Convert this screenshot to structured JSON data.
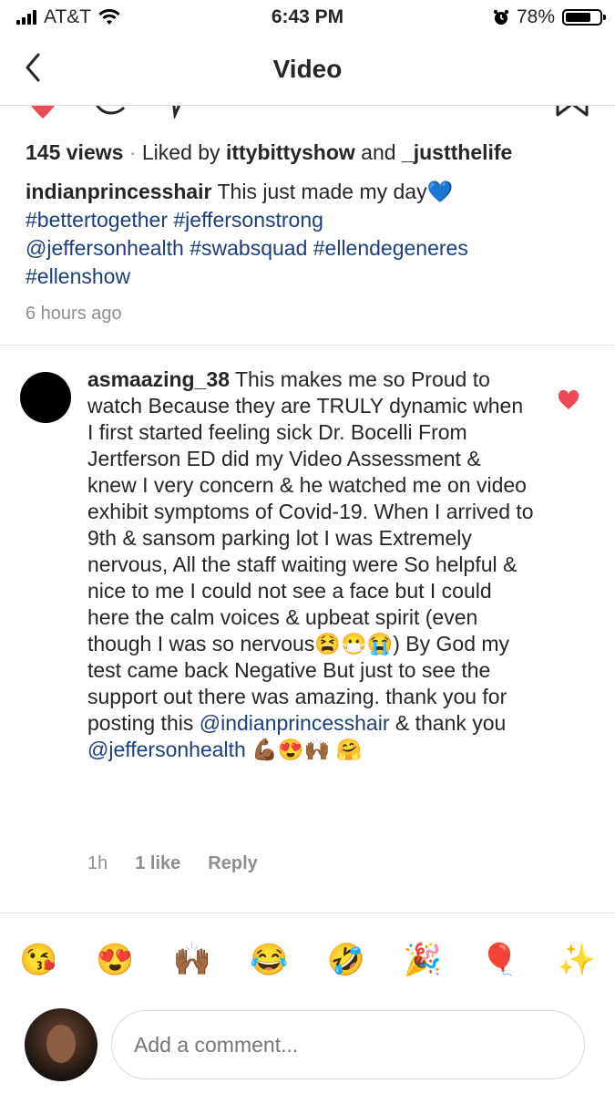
{
  "status_bar": {
    "carrier": "AT&T",
    "time": "6:43 PM",
    "battery": "78%",
    "battery_level": 0.78,
    "signal_icon": "signal-bars-icon",
    "wifi_icon": "wifi-icon",
    "alarm_icon": "alarm-clock-icon"
  },
  "nav": {
    "title": "Video",
    "back_icon": "chevron-left-icon"
  },
  "post": {
    "views": "145 views",
    "sep": " · ",
    "liked_by_prefix": "Liked by ",
    "liked_user_1": "ittybittyshow",
    "liked_and": " and ",
    "liked_user_2": "_justthelife",
    "author": "indianprincesshair",
    "caption_text": "This just made my day",
    "caption_emoji": "💙",
    "tags_line1": "#bettertogether #jeffersonstrong",
    "tags_line2": "@jeffersonhealth #swabsquad #ellendegeneres",
    "tags_line3": "#ellenshow",
    "time_ago": "6 hours ago"
  },
  "comment": {
    "username": "asmaazing_38",
    "text_1": "This makes me so Proud to watch Because they are TRULY dynamic when I first started feeling sick Dr. Bocelli From Jertferson ED did my Video Assessment & knew I very concern & he watched me on video exhibit symptoms of Covid-19. When I arrived to 9th & sansom parking lot I was Extremely nervous, All the staff waiting  were So helpful & nice to me I could not see a face but I could here the calm voices & upbeat spirit (even though I was so nervous",
    "emoji_1": "😫😷😭",
    "text_2": ") By God my test came back Negative But just to  see the support out there was amazing. thank you for posting this ",
    "mention_1": "@indianprincesshair",
    "text_3": " & thank you ",
    "mention_2": "@jeffersonhealth",
    "emoji_2": " 💪🏾😍🙌🏾 🤗",
    "time": "1h",
    "likes": "1 like",
    "reply": "Reply",
    "heart_color": "#ed4956"
  },
  "emoji_bar": [
    "😘",
    "😍",
    "🙌🏾",
    "😂",
    "🤣",
    "🎉",
    "🎈",
    "✨"
  ],
  "compose": {
    "placeholder": "Add a comment..."
  },
  "colors": {
    "link": "#1c3f7c",
    "muted": "#8e8e8e",
    "like_red": "#ed4956"
  }
}
